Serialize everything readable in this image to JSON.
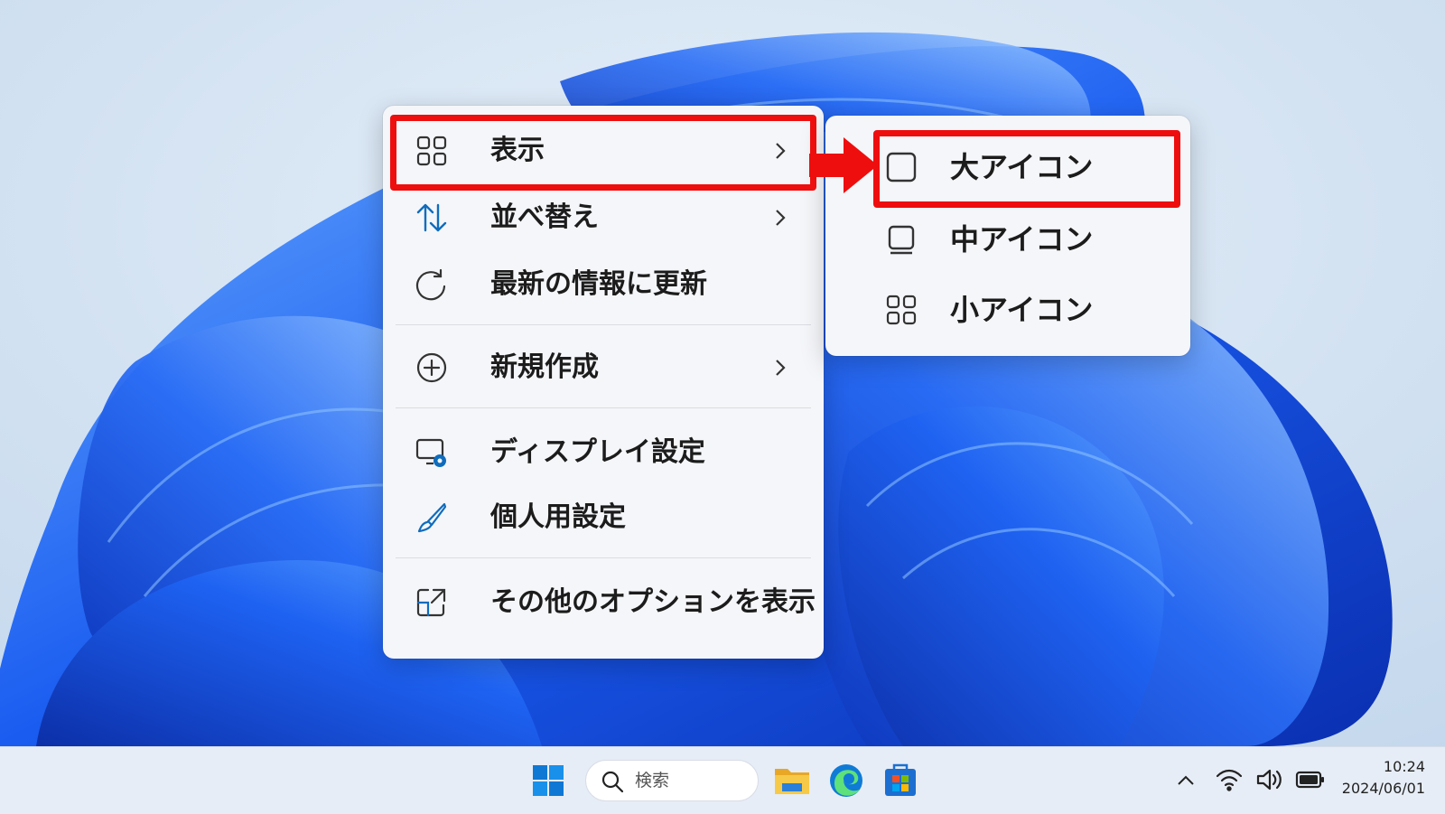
{
  "context_menu": {
    "items": [
      {
        "label": "表示",
        "icon": "grid-icon",
        "has_submenu": true
      },
      {
        "label": "並べ替え",
        "icon": "sort-arrows-icon",
        "has_submenu": true
      },
      {
        "label": "最新の情報に更新",
        "icon": "refresh-icon",
        "has_submenu": false
      },
      {
        "label": "新規作成",
        "icon": "plus-circle-icon",
        "has_submenu": true
      },
      {
        "label": "ディスプレイ設定",
        "icon": "display-settings-icon",
        "has_submenu": false
      },
      {
        "label": "個人用設定",
        "icon": "brush-icon",
        "has_submenu": false
      },
      {
        "label": "その他のオプションを表示",
        "icon": "expand-icon",
        "has_submenu": false
      }
    ]
  },
  "submenu": {
    "items": [
      {
        "label": "大アイコン",
        "icon": "large-icon-square-icon"
      },
      {
        "label": "中アイコン",
        "icon": "medium-icon-square-icon"
      },
      {
        "label": "小アイコン",
        "icon": "small-icon-grid-icon"
      }
    ]
  },
  "taskbar": {
    "search_label": "検索",
    "time": "10:24",
    "date": "2024/06/01",
    "apps": [
      "start-icon",
      "file-explorer-icon",
      "edge-icon",
      "store-icon"
    ],
    "tray": [
      "chevron-up-icon",
      "wifi-icon",
      "volume-icon",
      "battery-icon"
    ]
  },
  "colors": {
    "highlight": "#ee0e0e",
    "accent": "#0f6cbd",
    "menu_bg": "#f5f6f9"
  }
}
